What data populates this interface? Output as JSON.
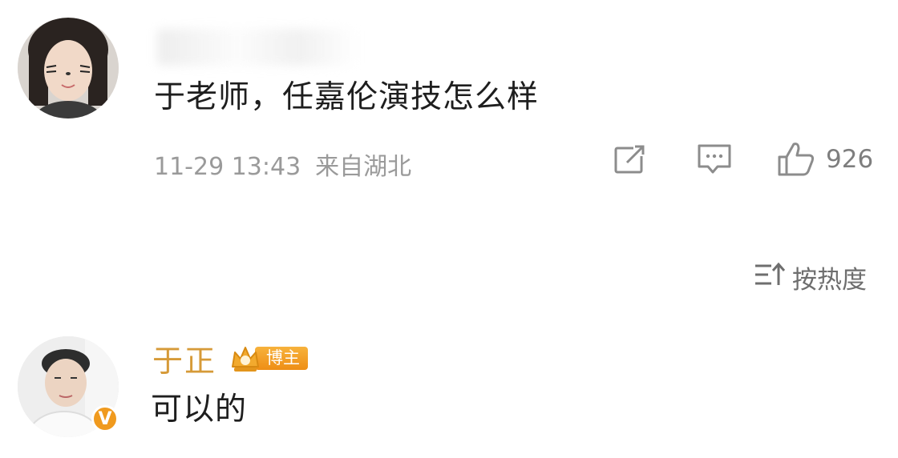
{
  "comments": [
    {
      "text": "于老师，任嘉伦演技怎么样",
      "date": "11-29 13:43",
      "location": "来自湖北",
      "likes": "926"
    },
    {
      "author": "于正",
      "author_badge": "博主",
      "text": "可以的",
      "verified_badge": "V"
    }
  ],
  "sort": {
    "label": "按热度"
  },
  "icons": {
    "share": "share-icon",
    "reply": "comment-icon",
    "like": "thumbs-up-icon",
    "sort": "sort-icon",
    "crown": "crown-icon"
  },
  "colors": {
    "author_name": "#d69a38",
    "badge": "#f09a1e",
    "meta_text": "#9a9a9a"
  }
}
